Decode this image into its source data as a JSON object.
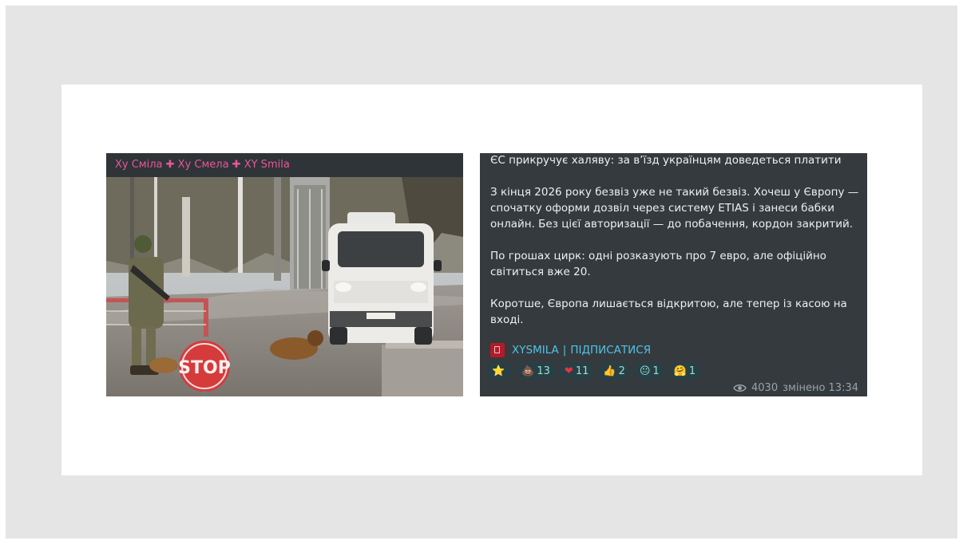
{
  "left_post": {
    "header_text": "Ху Сміла ✚ Ху Смела ✚ XY Smila",
    "photo": {
      "description_icon": "photo-icon",
      "sign_text": "STOP"
    }
  },
  "right_post": {
    "paragraphs": [
      "ЄС прикручує халяву: за в’їзд українцям доведеться платити",
      "З кінця 2026 року безвіз уже не такий безвіз. Хочеш у Європу —",
      "спочатку оформи дозвіл через систему ETIAS і занеси бабки",
      "онлайн. Без цієї авторизації — до побачення, кордон закритий.",
      "По грошах цирк: одні розказують про 7 евро, але офіційно",
      "світиться вже 20.",
      "Коротше, Європа лишається відкритою, але тепер із касою на",
      "вході."
    ],
    "link": {
      "channel": "XYSMILA",
      "separator": "|",
      "action": "ПІДПИСАТИСЯ"
    },
    "reactions": [
      {
        "emoji": "⭐",
        "count": ""
      },
      {
        "emoji": "💩",
        "count": "13"
      },
      {
        "emoji": "❤",
        "count": "11"
      },
      {
        "emoji": "👍",
        "count": "2"
      },
      {
        "emoji": "😐",
        "count": "1"
      },
      {
        "emoji": "🤗",
        "count": "1"
      }
    ],
    "views": "4030",
    "edited": "змінено 13:34"
  },
  "colors": {
    "accent_pink": "#e8579a",
    "link_blue": "#52c3e6",
    "bubble_bg": "#353a3e"
  }
}
